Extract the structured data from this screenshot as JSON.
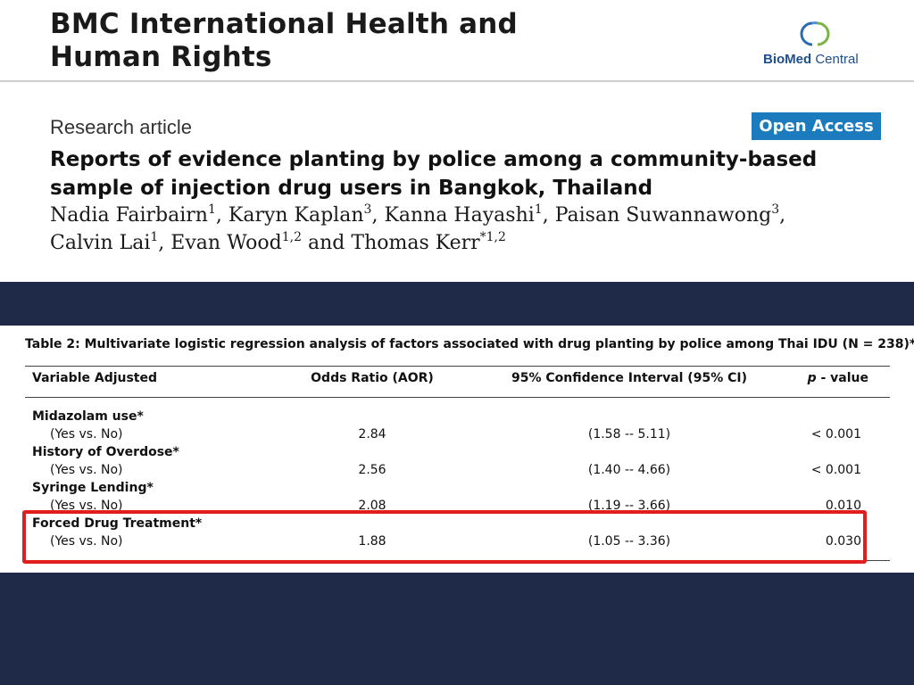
{
  "journal": {
    "title_line1": "BMC International Health and",
    "title_line2": "Human Rights",
    "publisher_bold": "BioMed",
    "publisher_light": " Central"
  },
  "article": {
    "type": "Research article",
    "access_badge": "Open Access",
    "title_line1": "Reports of evidence planting by police among a community-based",
    "title_line2": "sample of injection drug users in Bangkok, Thailand",
    "authors": [
      {
        "name": "Nadia Fairbairn",
        "sup": "1"
      },
      {
        "name": "Karyn Kaplan",
        "sup": "3"
      },
      {
        "name": "Kanna Hayashi",
        "sup": "1"
      },
      {
        "name": "Paisan  Suwannawong",
        "sup": "3"
      },
      {
        "name": "Calvin Lai",
        "sup": "1"
      },
      {
        "name": "Evan Wood",
        "sup": "1,2"
      },
      {
        "name": "Thomas Kerr",
        "sup": "*1,2"
      }
    ],
    "author_sep": ", ",
    "author_and": " and "
  },
  "table": {
    "caption": "Table 2: Multivariate logistic regression analysis of factors associated with drug planting by police among Thai IDU (N = 238)**",
    "headers": {
      "variable": "Variable Adjusted",
      "odds": "Odds Ratio (AOR)",
      "ci": "95% Confidence Interval (95% CI)",
      "p_italic": "p",
      "p_rest": " - value"
    },
    "rows": [
      {
        "variable": "Midazolam use*",
        "comparison": "(Yes vs. No)",
        "aor": "2.84",
        "ci": "(1.58 -- 5.11)",
        "p": "< 0.001"
      },
      {
        "variable": "History of Overdose*",
        "comparison": "(Yes vs. No)",
        "aor": "2.56",
        "ci": "(1.40 -- 4.66)",
        "p": "< 0.001"
      },
      {
        "variable": "Syringe Lending*",
        "comparison": "(Yes vs. No)",
        "aor": "2.08",
        "ci": "(1.19 -- 3.66)",
        "p": "0.010"
      },
      {
        "variable": "Forced Drug Treatment*",
        "comparison": "(Yes vs. No)",
        "aor": "1.88",
        "ci": "(1.05 -- 3.36)",
        "p": "0.030"
      }
    ],
    "highlighted_row": "Forced Drug Treatment*",
    "highlight_color": "#e01e1e"
  },
  "colors": {
    "background": "#1e2a47",
    "open_access": "#1b7bbd",
    "publisher": "#1f4f8f"
  }
}
